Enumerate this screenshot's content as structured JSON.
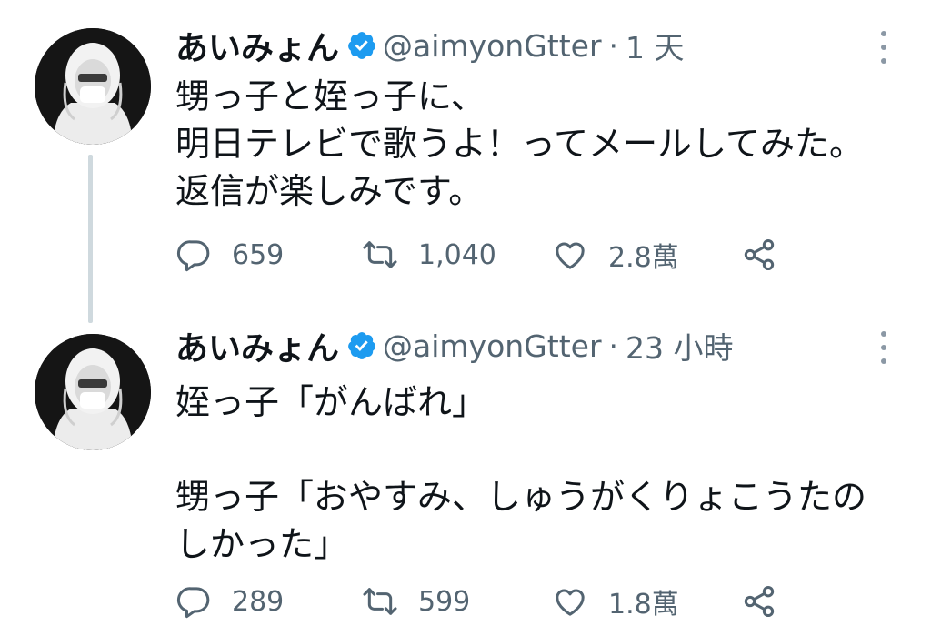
{
  "tweets": [
    {
      "display_name": "あいみょん",
      "handle": "@aimyonGtter",
      "separator": "·",
      "time": "1 天",
      "body_lines": [
        "甥っ子と姪っ子に、",
        "明日テレビで歌うよ！ってメールしてみた。",
        "返信が楽しみです。"
      ],
      "actions": {
        "replies": "659",
        "retweets": "1,040",
        "likes": "2.8萬"
      }
    },
    {
      "display_name": "あいみょん",
      "handle": "@aimyonGtter",
      "separator": "·",
      "time": "23 小時",
      "body_lines": [
        "姪っ子「がんばれ」",
        "",
        "甥っ子「おやすみ、しゅうがくりょこうたの",
        "しかった」"
      ],
      "actions": {
        "replies": "289",
        "retweets": "599",
        "likes": "1.8萬"
      }
    }
  ],
  "icons": {
    "verified": "verified-badge-icon",
    "more": "more-vertical-icon",
    "reply": "reply-icon",
    "retweet": "retweet-icon",
    "like": "heart-icon",
    "share": "share-icon"
  },
  "colors": {
    "text": "#0f1419",
    "secondary": "#536471",
    "verified": "#1d9bf0",
    "thread_line": "#cfd9de"
  }
}
